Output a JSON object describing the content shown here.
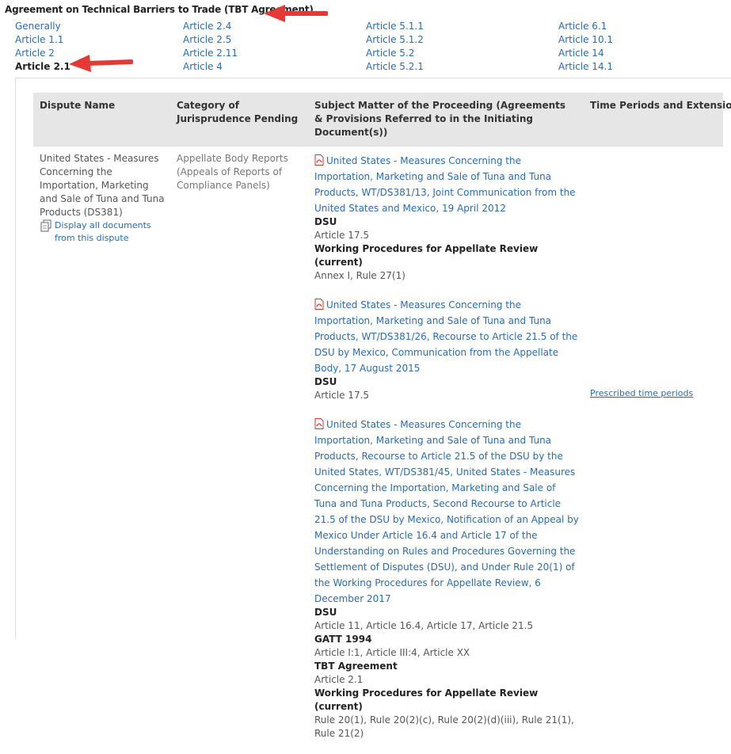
{
  "title": "Agreement on Technical Barriers to Trade (TBT Agreement)",
  "nav": {
    "columns": [
      [
        {
          "label": "Generally",
          "active": false
        },
        {
          "label": "Article 1.1",
          "active": false
        },
        {
          "label": "Article 2",
          "active": false
        },
        {
          "label": "Article 2.1",
          "active": true
        }
      ],
      [
        {
          "label": "Article 2.4"
        },
        {
          "label": "Article 2.5"
        },
        {
          "label": "Article 2.11"
        },
        {
          "label": "Article 4"
        }
      ],
      [
        {
          "label": "Article 5.1.1"
        },
        {
          "label": "Article 5.1.2"
        },
        {
          "label": "Article 5.2"
        },
        {
          "label": "Article 5.2.1"
        }
      ],
      [
        {
          "label": "Article 6.1"
        },
        {
          "label": "Article 10.1"
        },
        {
          "label": "Article 14"
        },
        {
          "label": "Article 14.1"
        }
      ]
    ]
  },
  "table": {
    "headers": {
      "dispute": "Dispute Name",
      "category": "Category of Jurisprudence Pending",
      "subject": "Subject Matter of the Proceeding (Agreements & Provisions Referred to in the Initiating Document(s))",
      "time": "Time Periods and Extensions"
    },
    "row": {
      "dispute": "United States - Measures Concerning the Importation, Marketing and Sale of Tuna and Tuna Products (DS381)",
      "display_link": "Display all documents from this dispute",
      "category": "Appellate Body Reports (Appeals of Reports of Compliance Panels)",
      "time_link": "Prescribed time periods",
      "documents": [
        {
          "link": "United States - Measures Concerning the Importation, Marketing and Sale of Tuna and Tuna Products, WT/DS381/13, Joint Communication from the United States and Mexico, 19 April 2012",
          "agreements": [
            {
              "name": "DSU",
              "provisions": "Article 17.5"
            },
            {
              "name": "Working Procedures for Appellate Review (current)",
              "provisions": "Annex I, Rule 27(1)"
            }
          ]
        },
        {
          "link": "United States - Measures Concerning the Importation, Marketing and Sale of Tuna and Tuna Products, WT/DS381/26, Recourse to Article 21.5 of the DSU by Mexico, Communication from the Appellate Body, 17 August 2015",
          "agreements": [
            {
              "name": "DSU",
              "provisions": "Article 17.5"
            }
          ]
        },
        {
          "link": "United States - Measures Concerning the Importation, Marketing and Sale of Tuna and Tuna Products, Recourse to Article 21.5 of the DSU by the United States, WT/DS381/45, United States - Measures Concerning the Importation, Marketing and Sale of Tuna and Tuna Products, Second Recourse to Article 21.5 of the DSU by Mexico, Notification of an Appeal by Mexico Under Article 16.4 and Article 17 of the Understanding on Rules and Procedures Governing the Settlement of Disputes (DSU), and Under Rule 20(1) of the Working Procedures for Appellate Review, 6 December 2017",
          "agreements": [
            {
              "name": "DSU",
              "provisions": "Article 11, Article 16.4, Article 17, Article 21.5"
            },
            {
              "name": "GATT 1994",
              "provisions": "Article I:1, Article III:4, Article XX"
            },
            {
              "name": "TBT Agreement",
              "provisions": "Article 2.1"
            },
            {
              "name": "Working Procedures for Appellate Review (current)",
              "provisions": "Rule 20(1), Rule 20(2)(c), Rule 20(2)(d)(iii), Rule 21(1), Rule 21(2)"
            }
          ]
        }
      ]
    }
  },
  "annotations": {
    "arrow_color": "#e53935"
  }
}
